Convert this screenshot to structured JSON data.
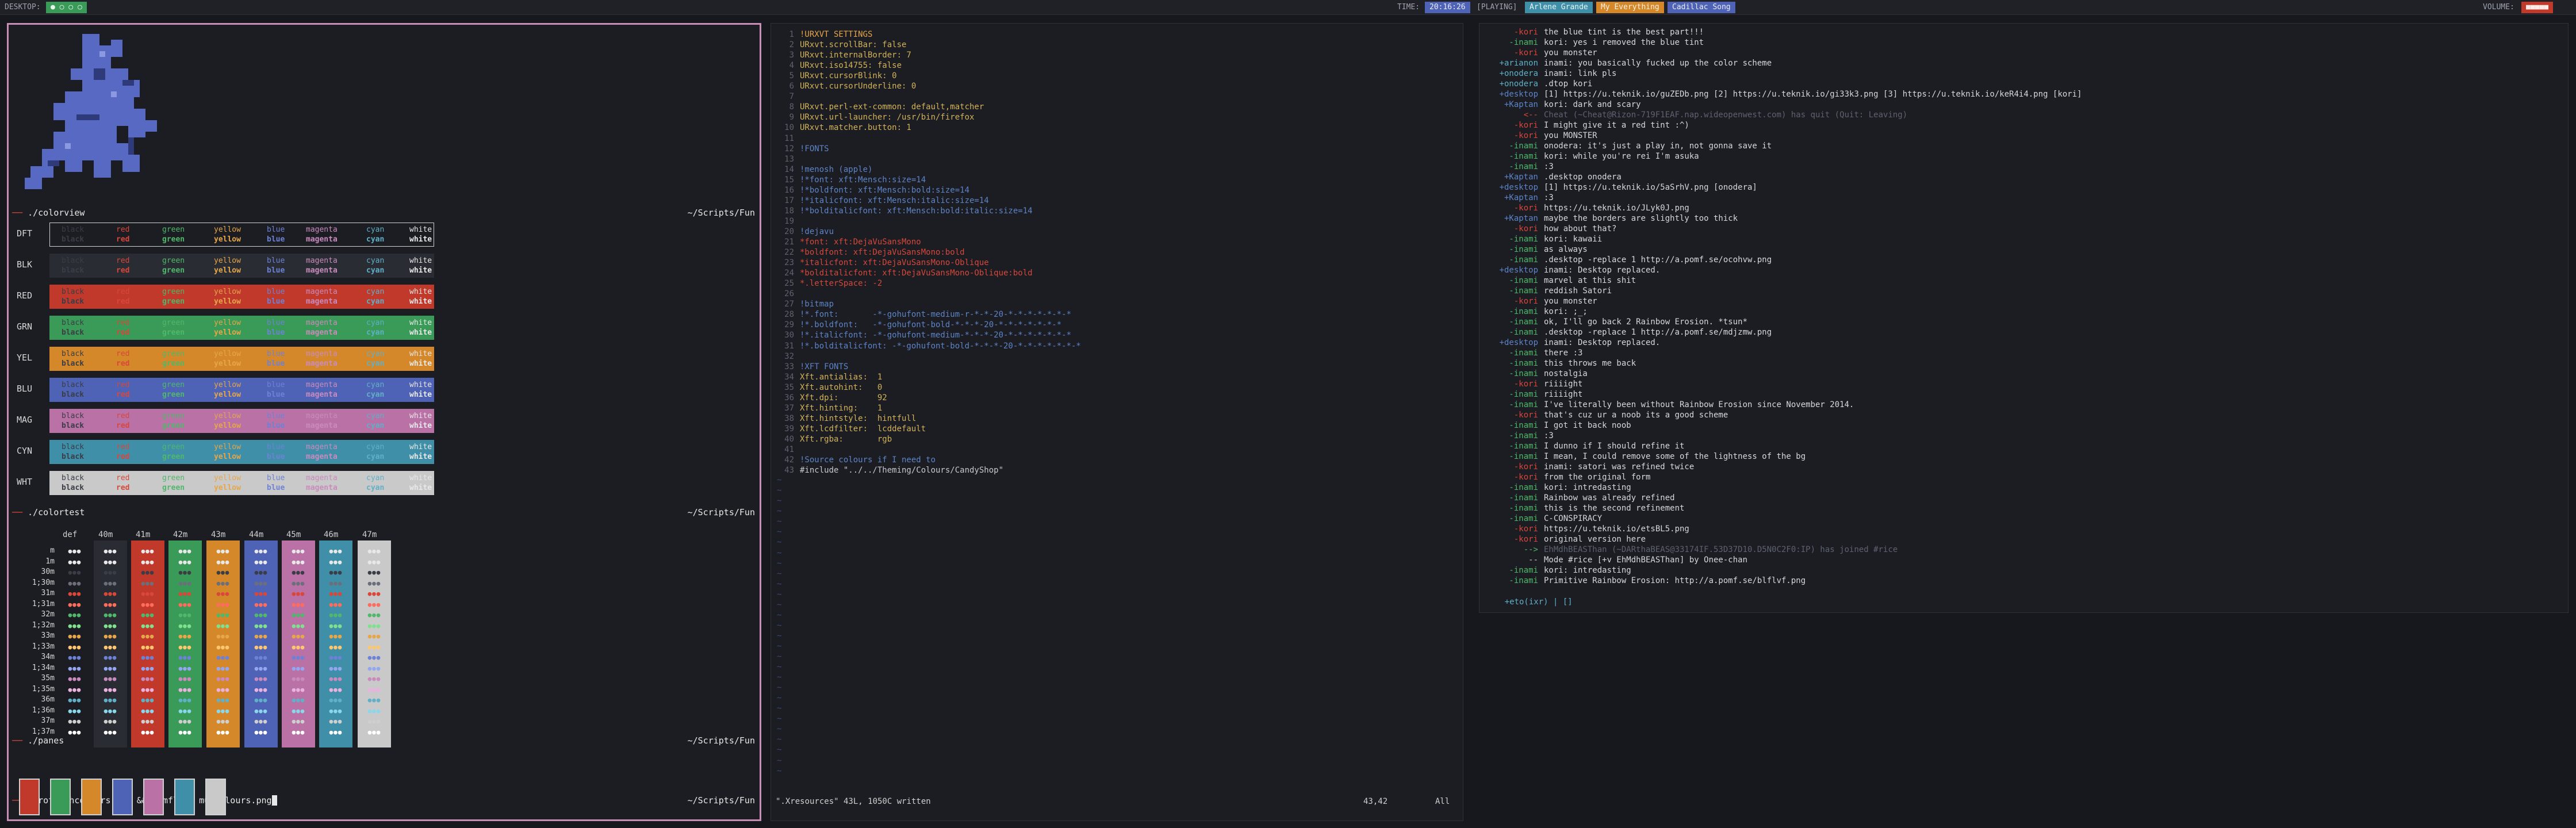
{
  "topbar": {
    "desktop_label": "DESKTOP:",
    "desktop_indicator": "● ○ ○ ○",
    "time_label": "TIME:",
    "time": "20:16:26",
    "playing_label": "[PLAYING]",
    "tracks": [
      "Arlene Grande",
      "My Everything",
      "Cadillac Song"
    ],
    "volume_label": "VOLUME:",
    "volume_bar": "■■■■■"
  },
  "left": {
    "colorview": {
      "cmd": "./colorview",
      "path": "~/Scripts/Fun",
      "rows": [
        {
          "label": "DFT",
          "bg": "#1b1d22",
          "border": "#cfcfcf"
        },
        {
          "label": "BLK",
          "bg": "#2a2c33",
          "border": "#2a2c33"
        },
        {
          "label": "RED",
          "bg": "#c0392b",
          "border": "#c0392b"
        },
        {
          "label": "GRN",
          "bg": "#3a9a58",
          "border": "#3a9a58"
        },
        {
          "label": "YEL",
          "bg": "#d4882a",
          "border": "#d4882a"
        },
        {
          "label": "BLU",
          "bg": "#4f63b6",
          "border": "#4f63b6"
        },
        {
          "label": "MAG",
          "bg": "#b971a6",
          "border": "#b971a6"
        },
        {
          "label": "CYN",
          "bg": "#3f8fa8",
          "border": "#3f8fa8"
        },
        {
          "label": "WHT",
          "bg": "#c9c9c9",
          "border": "#c9c9c9"
        }
      ],
      "words": [
        "black",
        "red",
        "green",
        "yellow",
        "blue",
        "magenta",
        "cyan",
        "white"
      ],
      "word_colors": [
        "#3a3d45",
        "#d8473a",
        "#4fb86a",
        "#e6a64a",
        "#6d82d6",
        "#c98bbd",
        "#5fb0c8",
        "#e8e8e8"
      ]
    },
    "colortest": {
      "cmd": "./colortest",
      "path": "~/Scripts/Fun",
      "headers": [
        "def",
        "40m",
        "41m",
        "42m",
        "43m",
        "44m",
        "45m",
        "46m",
        "47m"
      ],
      "row_labels": [
        "m",
        "1m",
        "30m",
        "1;30m",
        "31m",
        "1;31m",
        "32m",
        "1;32m",
        "33m",
        "1;33m",
        "34m",
        "1;34m",
        "35m",
        "1;35m",
        "36m",
        "1;36m",
        "37m",
        "1;37m"
      ],
      "glyph": "●●●"
    },
    "panes": {
      "cmd": "./panes",
      "path": "~/Scripts/Fun",
      "colors": [
        "#c0392b",
        "#3a9a58",
        "#d4882a",
        "#4f63b6",
        "#b971a6",
        "#3f8fa8",
        "#c9c9c9"
      ]
    },
    "prompt": {
      "cmd": "scrot muhcolours.png && pomfload muhcolours.png",
      "path": "~/Scripts/Fun"
    }
  },
  "vim": {
    "lines": [
      {
        "n": "1",
        "t": "!URXVT SETTINGS",
        "c": "#e6a64a"
      },
      {
        "n": "2",
        "t": "URxvt.scrollBar: false",
        "c": "#d2b25a"
      },
      {
        "n": "3",
        "t": "URxvt.internalBorder: 7",
        "c": "#d2b25a"
      },
      {
        "n": "4",
        "t": "URxvt.iso14755: false",
        "c": "#d2b25a"
      },
      {
        "n": "5",
        "t": "URxvt.cursorBlink: 0",
        "c": "#d2b25a"
      },
      {
        "n": "6",
        "t": "URxvt.cursorUnderline: 0",
        "c": "#d2b25a"
      },
      {
        "n": "7",
        "t": "",
        "c": "#c6c8ce"
      },
      {
        "n": "8",
        "t": "URxvt.perl-ext-common: default,matcher",
        "c": "#d2b25a"
      },
      {
        "n": "9",
        "t": "URxvt.url-launcher: /usr/bin/firefox",
        "c": "#d2b25a"
      },
      {
        "n": "10",
        "t": "URxvt.matcher.button: 1",
        "c": "#d2b25a"
      },
      {
        "n": "11",
        "t": "",
        "c": "#c6c8ce"
      },
      {
        "n": "12",
        "t": "!FONTS",
        "c": "#5e84c8"
      },
      {
        "n": "13",
        "t": "",
        "c": "#c6c8ce"
      },
      {
        "n": "14",
        "t": "!menosh (apple)",
        "c": "#5e84c8"
      },
      {
        "n": "15",
        "t": "!*font: xft:Mensch:size=14",
        "c": "#5e84c8"
      },
      {
        "n": "16",
        "t": "!*boldfont: xft:Mensch:bold:size=14",
        "c": "#5e84c8"
      },
      {
        "n": "17",
        "t": "!*italicfont: xft:Mensch:italic:size=14",
        "c": "#5e84c8"
      },
      {
        "n": "18",
        "t": "!*bolditalicfont: xft:Mensch:bold:italic:size=14",
        "c": "#5e84c8"
      },
      {
        "n": "19",
        "t": "",
        "c": "#c6c8ce"
      },
      {
        "n": "20",
        "t": "!dejavu",
        "c": "#5e84c8"
      },
      {
        "n": "21",
        "t": "*font: xft:DejaVuSansMono",
        "c": "#d8473a"
      },
      {
        "n": "22",
        "t": "*boldfont: xft:DejaVuSansMono:bold",
        "c": "#d8473a"
      },
      {
        "n": "23",
        "t": "*italicfont: xft:DejaVuSansMono-Oblique",
        "c": "#d8473a"
      },
      {
        "n": "24",
        "t": "*bolditalicfont: xft:DejaVuSansMono-Oblique:bold",
        "c": "#d8473a"
      },
      {
        "n": "25",
        "t": "*.letterSpace: -2",
        "c": "#d8473a"
      },
      {
        "n": "26",
        "t": "",
        "c": "#c6c8ce"
      },
      {
        "n": "27",
        "t": "!bitmap",
        "c": "#5e84c8"
      },
      {
        "n": "28",
        "t": "!*.font:       -*-gohufont-medium-r-*-*-20-*-*-*-*-*-*-*",
        "c": "#5e84c8"
      },
      {
        "n": "29",
        "t": "!*.boldfont:   -*-gohufont-bold-*-*-*-20-*-*-*-*-*-*-*",
        "c": "#5e84c8"
      },
      {
        "n": "30",
        "t": "!*.italicfont: -*-gohufont-medium-*-*-*-20-*-*-*-*-*-*-*",
        "c": "#5e84c8"
      },
      {
        "n": "31",
        "t": "!*.bolditalicfont: -*-gohufont-bold-*-*-*-20-*-*-*-*-*-*-*",
        "c": "#5e84c8"
      },
      {
        "n": "32",
        "t": "",
        "c": "#c6c8ce"
      },
      {
        "n": "33",
        "t": "!XFT FONTS",
        "c": "#5e84c8"
      },
      {
        "n": "34",
        "t": "Xft.antialias:  1",
        "c": "#d2b25a"
      },
      {
        "n": "35",
        "t": "Xft.autohint:   0",
        "c": "#d2b25a"
      },
      {
        "n": "36",
        "t": "Xft.dpi:        92",
        "c": "#d2b25a"
      },
      {
        "n": "37",
        "t": "Xft.hinting:    1",
        "c": "#d2b25a"
      },
      {
        "n": "38",
        "t": "Xft.hintstyle:  hintfull",
        "c": "#d2b25a"
      },
      {
        "n": "39",
        "t": "Xft.lcdfilter:  lcddefault",
        "c": "#d2b25a"
      },
      {
        "n": "40",
        "t": "Xft.rgba:       rgb",
        "c": "#d2b25a"
      },
      {
        "n": "41",
        "t": "",
        "c": "#c6c8ce"
      },
      {
        "n": "42",
        "t": "!Source colours if I need to",
        "c": "#5e84c8"
      },
      {
        "n": "43",
        "t": "#include \"../../Theming/Colours/CandyShop\"",
        "c": "#c6c8ce"
      }
    ],
    "status_file": "\".Xresources\" 43L, 1050C written",
    "status_pos": "43,42",
    "status_all": "All"
  },
  "chat": {
    "lines": [
      {
        "nick": "-kori",
        "nc": "#d8473a",
        "msg": "the blue tint is the best part!!!"
      },
      {
        "nick": "-inami",
        "nc": "#4fb86a",
        "msg": "kori: yes i removed the blue tint"
      },
      {
        "nick": "-kori",
        "nc": "#d8473a",
        "msg": "you monster"
      },
      {
        "nick": "+arianon",
        "nc": "#5fb0c8",
        "msg": "inami: you basically fucked up the color scheme"
      },
      {
        "nick": "+onodera",
        "nc": "#5fb0c8",
        "msg": "inami: link pls"
      },
      {
        "nick": "+onodera",
        "nc": "#5fb0c8",
        "msg": ".dtop kori"
      },
      {
        "nick": "+desktop",
        "nc": "#5e84c8",
        "msg": "[1] https://u.teknik.io/guZEDb.png [2] https://u.teknik.io/gi33k3.png [3] https://u.teknik.io/keR4i4.png [kori]"
      },
      {
        "nick": "+Kaptan",
        "nc": "#5e84c8",
        "msg": "kori: dark and scary"
      },
      {
        "nick": "<--",
        "nc": "#d8473a",
        "msg": "Cheat (~Cheat@Rizon-719F1EAF.nap.wideopenwest.com) has quit (Quit: Leaving)"
      },
      {
        "nick": "-kori",
        "nc": "#d8473a",
        "msg": "I might give it a red tint :^)"
      },
      {
        "nick": "-kori",
        "nc": "#d8473a",
        "msg": "you MONSTER"
      },
      {
        "nick": "-inami",
        "nc": "#4fb86a",
        "msg": "onodera: it's just a play in, not gonna save it"
      },
      {
        "nick": "-inami",
        "nc": "#4fb86a",
        "msg": "kori: while you're rei I'm asuka"
      },
      {
        "nick": "-inami",
        "nc": "#4fb86a",
        "msg": ":3"
      },
      {
        "nick": "+Kaptan",
        "nc": "#5e84c8",
        "msg": ".desktop onodera"
      },
      {
        "nick": "+desktop",
        "nc": "#5e84c8",
        "msg": "[1] https://u.teknik.io/5aSrhV.png [onodera]"
      },
      {
        "nick": "+Kaptan",
        "nc": "#5e84c8",
        "msg": ":3"
      },
      {
        "nick": "-kori",
        "nc": "#d8473a",
        "msg": "https://u.teknik.io/JLyk0J.png"
      },
      {
        "nick": "+Kaptan",
        "nc": "#5e84c8",
        "msg": "maybe the borders are slightly too thick"
      },
      {
        "nick": "-kori",
        "nc": "#d8473a",
        "msg": "how about that?"
      },
      {
        "nick": "-inami",
        "nc": "#4fb86a",
        "msg": "kori: kawaii"
      },
      {
        "nick": "-inami",
        "nc": "#4fb86a",
        "msg": "as always"
      },
      {
        "nick": "-inami",
        "nc": "#4fb86a",
        "msg": ".desktop -replace 1 http://a.pomf.se/ocohvw.png"
      },
      {
        "nick": "+desktop",
        "nc": "#5e84c8",
        "msg": "inami: Desktop replaced."
      },
      {
        "nick": "-inami",
        "nc": "#4fb86a",
        "msg": "marvel at this shit"
      },
      {
        "nick": "-inami",
        "nc": "#4fb86a",
        "msg": "reddish Satori"
      },
      {
        "nick": "-kori",
        "nc": "#d8473a",
        "msg": "you monster"
      },
      {
        "nick": "-inami",
        "nc": "#4fb86a",
        "msg": "kori: ;_;"
      },
      {
        "nick": "-inami",
        "nc": "#4fb86a",
        "msg": "ok, I'll go back 2 Rainbow Erosion. *tsun*"
      },
      {
        "nick": "-inami",
        "nc": "#4fb86a",
        "msg": ".desktop -replace 1 http://a.pomf.se/mdjzmw.png"
      },
      {
        "nick": "+desktop",
        "nc": "#5e84c8",
        "msg": "inami: Desktop replaced."
      },
      {
        "nick": "-inami",
        "nc": "#4fb86a",
        "msg": "there :3"
      },
      {
        "nick": "-inami",
        "nc": "#4fb86a",
        "msg": "this throws me back"
      },
      {
        "nick": "-inami",
        "nc": "#4fb86a",
        "msg": "nostalgia"
      },
      {
        "nick": "-kori",
        "nc": "#d8473a",
        "msg": "riiiight"
      },
      {
        "nick": "-inami",
        "nc": "#4fb86a",
        "msg": "riiiight"
      },
      {
        "nick": "-inami",
        "nc": "#4fb86a",
        "msg": "I've literally been without Rainbow Erosion since November 2014."
      },
      {
        "nick": "-kori",
        "nc": "#d8473a",
        "msg": "that's cuz ur a noob its a good scheme"
      },
      {
        "nick": "-inami",
        "nc": "#4fb86a",
        "msg": "I got it back noob"
      },
      {
        "nick": "-inami",
        "nc": "#4fb86a",
        "msg": ":3"
      },
      {
        "nick": "-inami",
        "nc": "#4fb86a",
        "msg": "I dunno if I should refine it"
      },
      {
        "nick": "-inami",
        "nc": "#4fb86a",
        "msg": "I mean, I could remove some of the lightness of the bg"
      },
      {
        "nick": "-kori",
        "nc": "#d8473a",
        "msg": "inami: satori was refined twice"
      },
      {
        "nick": "-kori",
        "nc": "#d8473a",
        "msg": "from the original form"
      },
      {
        "nick": "-inami",
        "nc": "#4fb86a",
        "msg": "kori: intredasting"
      },
      {
        "nick": "-inami",
        "nc": "#4fb86a",
        "msg": "Rainbow was already refined"
      },
      {
        "nick": "-inami",
        "nc": "#4fb86a",
        "msg": "this is the second refinement"
      },
      {
        "nick": "-inami",
        "nc": "#4fb86a",
        "msg": "C-CONSPIRACY"
      },
      {
        "nick": "-kori",
        "nc": "#d8473a",
        "msg": "https://u.teknik.io/etsBL5.png"
      },
      {
        "nick": "-kori",
        "nc": "#d8473a",
        "msg": "original version here"
      },
      {
        "nick": "-->",
        "nc": "#4fb86a",
        "msg": "EhMdhBEASThan (~DARthaBEAS@33174IF.53D37D10.D5N0C2F0:IP) has joined #rice"
      },
      {
        "nick": "--",
        "nc": "#c6c8ce",
        "msg": "Mode #rice [+v EhMdhBEASThan] by Onee-chan"
      },
      {
        "nick": "-inami",
        "nc": "#4fb86a",
        "msg": "kori: intredasting"
      },
      {
        "nick": "-inami",
        "nc": "#4fb86a",
        "msg": "Primitive Rainbow Erosion: http://a.pomf.se/blflvf.png"
      }
    ],
    "input_prompt": "+eto(ixr) | []"
  }
}
